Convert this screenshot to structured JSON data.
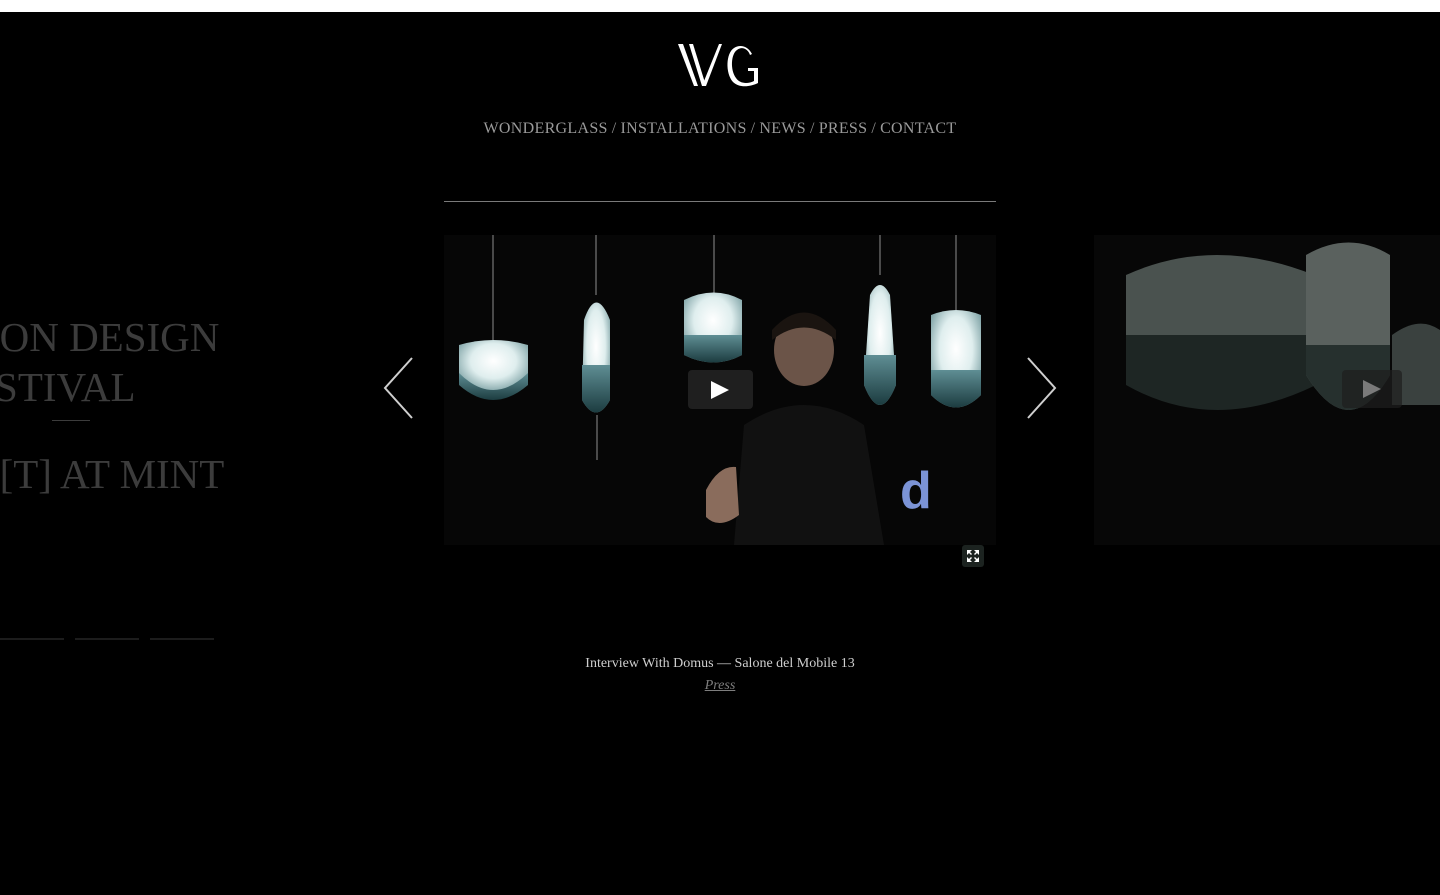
{
  "nav": {
    "items": [
      "WONDERGLASS",
      "INSTALLATIONS",
      "NEWS",
      "PRESS",
      "CONTACT"
    ],
    "separator": "/"
  },
  "left_slide": {
    "line1": "DON DESIGN",
    "line2": "ESTIVAL",
    "line3": "V[T] AT MINT"
  },
  "video": {
    "overlay_letter": "d",
    "play_icon": "play-icon",
    "fullscreen_icon": "fullscreen-icon"
  },
  "caption": {
    "title": "Interview With Domus — Salone del Mobile 13",
    "category": "Press"
  },
  "colors": {
    "background": "#000000",
    "nav_text": "#9a9a9a",
    "overlay_letter": "#7b93d6"
  }
}
